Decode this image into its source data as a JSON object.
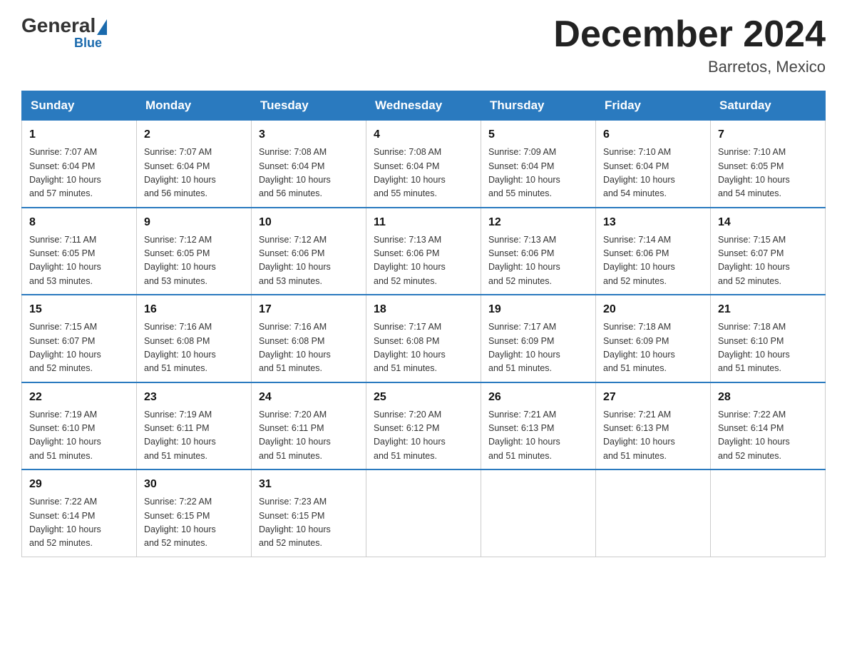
{
  "header": {
    "logo": {
      "general": "General",
      "blue": "Blue"
    },
    "title": "December 2024",
    "location": "Barretos, Mexico"
  },
  "weekdays": [
    "Sunday",
    "Monday",
    "Tuesday",
    "Wednesday",
    "Thursday",
    "Friday",
    "Saturday"
  ],
  "weeks": [
    [
      {
        "day": "1",
        "sunrise": "7:07 AM",
        "sunset": "6:04 PM",
        "daylight": "10 hours and 57 minutes."
      },
      {
        "day": "2",
        "sunrise": "7:07 AM",
        "sunset": "6:04 PM",
        "daylight": "10 hours and 56 minutes."
      },
      {
        "day": "3",
        "sunrise": "7:08 AM",
        "sunset": "6:04 PM",
        "daylight": "10 hours and 56 minutes."
      },
      {
        "day": "4",
        "sunrise": "7:08 AM",
        "sunset": "6:04 PM",
        "daylight": "10 hours and 55 minutes."
      },
      {
        "day": "5",
        "sunrise": "7:09 AM",
        "sunset": "6:04 PM",
        "daylight": "10 hours and 55 minutes."
      },
      {
        "day": "6",
        "sunrise": "7:10 AM",
        "sunset": "6:04 PM",
        "daylight": "10 hours and 54 minutes."
      },
      {
        "day": "7",
        "sunrise": "7:10 AM",
        "sunset": "6:05 PM",
        "daylight": "10 hours and 54 minutes."
      }
    ],
    [
      {
        "day": "8",
        "sunrise": "7:11 AM",
        "sunset": "6:05 PM",
        "daylight": "10 hours and 53 minutes."
      },
      {
        "day": "9",
        "sunrise": "7:12 AM",
        "sunset": "6:05 PM",
        "daylight": "10 hours and 53 minutes."
      },
      {
        "day": "10",
        "sunrise": "7:12 AM",
        "sunset": "6:06 PM",
        "daylight": "10 hours and 53 minutes."
      },
      {
        "day": "11",
        "sunrise": "7:13 AM",
        "sunset": "6:06 PM",
        "daylight": "10 hours and 52 minutes."
      },
      {
        "day": "12",
        "sunrise": "7:13 AM",
        "sunset": "6:06 PM",
        "daylight": "10 hours and 52 minutes."
      },
      {
        "day": "13",
        "sunrise": "7:14 AM",
        "sunset": "6:06 PM",
        "daylight": "10 hours and 52 minutes."
      },
      {
        "day": "14",
        "sunrise": "7:15 AM",
        "sunset": "6:07 PM",
        "daylight": "10 hours and 52 minutes."
      }
    ],
    [
      {
        "day": "15",
        "sunrise": "7:15 AM",
        "sunset": "6:07 PM",
        "daylight": "10 hours and 52 minutes."
      },
      {
        "day": "16",
        "sunrise": "7:16 AM",
        "sunset": "6:08 PM",
        "daylight": "10 hours and 51 minutes."
      },
      {
        "day": "17",
        "sunrise": "7:16 AM",
        "sunset": "6:08 PM",
        "daylight": "10 hours and 51 minutes."
      },
      {
        "day": "18",
        "sunrise": "7:17 AM",
        "sunset": "6:08 PM",
        "daylight": "10 hours and 51 minutes."
      },
      {
        "day": "19",
        "sunrise": "7:17 AM",
        "sunset": "6:09 PM",
        "daylight": "10 hours and 51 minutes."
      },
      {
        "day": "20",
        "sunrise": "7:18 AM",
        "sunset": "6:09 PM",
        "daylight": "10 hours and 51 minutes."
      },
      {
        "day": "21",
        "sunrise": "7:18 AM",
        "sunset": "6:10 PM",
        "daylight": "10 hours and 51 minutes."
      }
    ],
    [
      {
        "day": "22",
        "sunrise": "7:19 AM",
        "sunset": "6:10 PM",
        "daylight": "10 hours and 51 minutes."
      },
      {
        "day": "23",
        "sunrise": "7:19 AM",
        "sunset": "6:11 PM",
        "daylight": "10 hours and 51 minutes."
      },
      {
        "day": "24",
        "sunrise": "7:20 AM",
        "sunset": "6:11 PM",
        "daylight": "10 hours and 51 minutes."
      },
      {
        "day": "25",
        "sunrise": "7:20 AM",
        "sunset": "6:12 PM",
        "daylight": "10 hours and 51 minutes."
      },
      {
        "day": "26",
        "sunrise": "7:21 AM",
        "sunset": "6:13 PM",
        "daylight": "10 hours and 51 minutes."
      },
      {
        "day": "27",
        "sunrise": "7:21 AM",
        "sunset": "6:13 PM",
        "daylight": "10 hours and 51 minutes."
      },
      {
        "day": "28",
        "sunrise": "7:22 AM",
        "sunset": "6:14 PM",
        "daylight": "10 hours and 52 minutes."
      }
    ],
    [
      {
        "day": "29",
        "sunrise": "7:22 AM",
        "sunset": "6:14 PM",
        "daylight": "10 hours and 52 minutes."
      },
      {
        "day": "30",
        "sunrise": "7:22 AM",
        "sunset": "6:15 PM",
        "daylight": "10 hours and 52 minutes."
      },
      {
        "day": "31",
        "sunrise": "7:23 AM",
        "sunset": "6:15 PM",
        "daylight": "10 hours and 52 minutes."
      },
      null,
      null,
      null,
      null
    ]
  ],
  "labels": {
    "sunrise": "Sunrise:",
    "sunset": "Sunset:",
    "daylight": "Daylight:"
  }
}
